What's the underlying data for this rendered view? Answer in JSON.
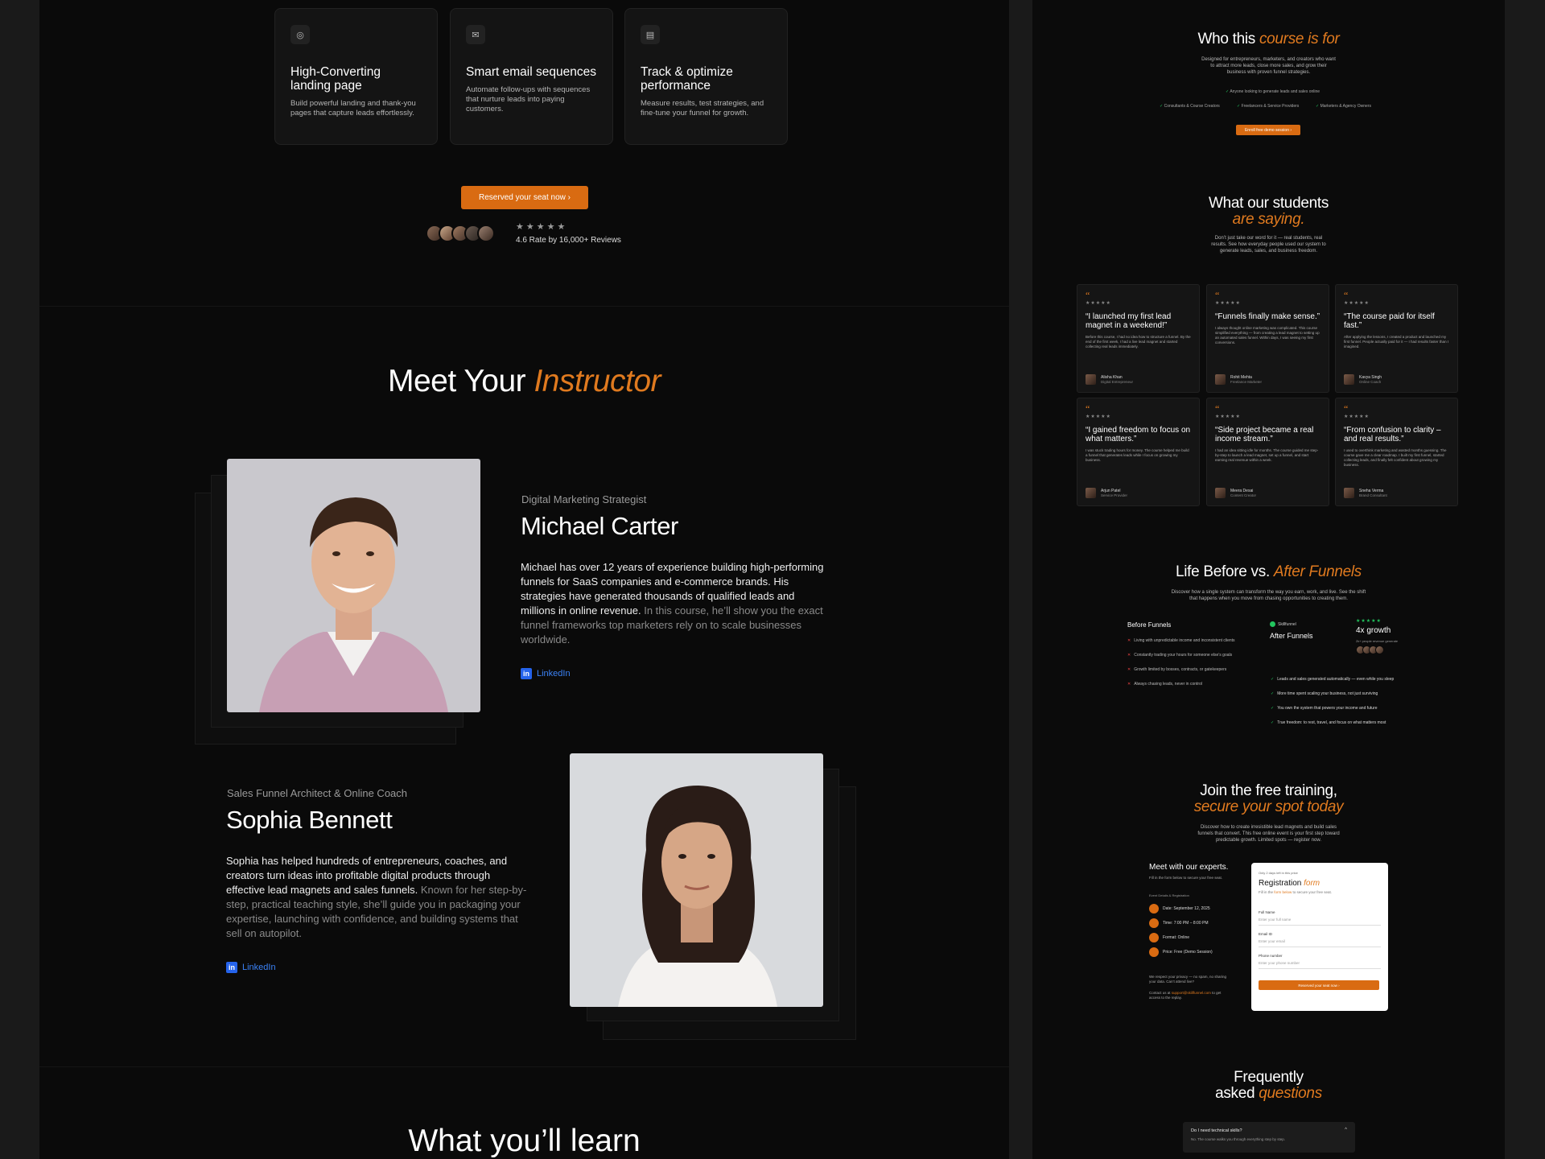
{
  "features": [
    {
      "icon": "globe-icon",
      "title": "High-Converting landing page",
      "desc": "Build powerful landing and thank-you pages that capture leads effortlessly."
    },
    {
      "icon": "mail-icon",
      "title": "Smart email sequences",
      "desc": "Automate follow-ups with sequences that nurture leads into paying customers."
    },
    {
      "icon": "chart-file-icon",
      "title": "Track & optimize performance",
      "desc": "Measure results, test strategies, and fine-tune your funnel for growth."
    }
  ],
  "cta": {
    "reserve_label": "Reserved your seat now  ›"
  },
  "rating": {
    "stars": "★★★★★",
    "text": "4.6 Rate by 16,000+ Reviews"
  },
  "meet": {
    "title_a": "Meet Your ",
    "title_b": "Instructor"
  },
  "instructors": [
    {
      "role": "Digital Marketing Strategist",
      "name": "Michael Carter",
      "bio_main": "Michael has over 12 years of experience building high-performing funnels for SaaS companies and e-commerce brands. His strategies have generated thousands of qualified leads and millions in online revenue.",
      "bio_muted": " In this course, he’ll show you the exact funnel frameworks top marketers rely on to scale businesses worldwide.",
      "link": "LinkedIn"
    },
    {
      "role": "Sales Funnel Architect & Online Coach",
      "name": "Sophia Bennett",
      "bio_main": "Sophia has helped hundreds of entrepreneurs, coaches, and creators turn ideas into profitable digital products through effective lead magnets and sales funnels.",
      "bio_muted": " Known for her step-by-step, practical teaching style, she’ll guide you in packaging your expertise, launching with confidence, and building systems that sell on autopilot.",
      "link": "LinkedIn"
    }
  ],
  "learn": {
    "title": "What you’ll learn"
  },
  "who": {
    "title_a": "Who this ",
    "title_b": "course is for",
    "desc": "Designed for entrepreneurs, marketers, and creators who want to attract more leads, close more sales, and grow their business with proven funnel strategies.",
    "tags": [
      "Anyone looking to generate leads and sales online",
      "Consultants & Course Creators",
      "Freelancers & Service Providers",
      "Marketers & Agency Owners"
    ],
    "btn": "Enroll free demo session  ›"
  },
  "students": {
    "title_a": "What our students",
    "title_b": "are saying.",
    "desc": "Don’t just take our word for it — real students, real results. See how everyday people used our system to generate leads, sales, and business freedom.",
    "cards": [
      {
        "title": "“I launched my first lead magnet in a weekend!”",
        "body": "Before this course, I had no idea how to structure a funnel. By the end of the first week, I had a live lead magnet and started collecting real leads immediately.",
        "name": "Alisha Khan",
        "role": "Digital Entrepreneur"
      },
      {
        "title": "“Funnels finally make sense.”",
        "body": "I always thought online marketing was complicated. This course simplified everything — from creating a lead magnet to setting up an automated sales funnel. Within days, I was seeing my first conversions.",
        "name": "Rohit Mehta",
        "role": "Freelance Marketer"
      },
      {
        "title": "“The course paid for itself fast.”",
        "body": "After applying the lessons, I created a product and launched my first funnel. People actually paid for it — I had results faster than I imagined.",
        "name": "Kavya Singh",
        "role": "Online Coach"
      },
      {
        "title": "“I gained freedom to focus on what matters.”",
        "body": "I was stuck trading hours for money. The course helped me build a funnel that generates leads while I focus on growing my business.",
        "name": "Arjun Patel",
        "role": "Service Provider"
      },
      {
        "title": "“Side project became a real income stream.”",
        "body": "I had an idea sitting idle for months. The course guided me step-by-step to launch a lead magnet, set up a funnel, and start earning real revenue within a week.",
        "name": "Meera Desai",
        "role": "Content Creator"
      },
      {
        "title": "“From confusion to clarity – and real results.”",
        "body": "I used to overthink marketing and wasted months guessing. The course gave me a clear roadmap. I built my first funnel, started collecting leads, and finally felt confident about growing my business.",
        "name": "Sneha Verma",
        "role": "Brand Consultant"
      }
    ],
    "stars": "★★★★★"
  },
  "life": {
    "title_a": "Life Before vs. ",
    "title_b": "After Funnels",
    "desc": "Discover how a single system can transform the way you earn, work, and live. See the shift that happens when you move from chasing opportunities to creating them.",
    "before_title": "Before Funnels",
    "before": [
      "Living with unpredictable income and inconsistent clients",
      "Constantly trading your hours for someone else’s goals",
      "Growth limited by bosses, contracts, or gatekeepers",
      "Always chasing leads, never in control"
    ],
    "brand": "Skillfunnel",
    "after_title": "After Funnels",
    "growth_stars": "★★★★★",
    "growth": "4x growth",
    "growth_sub": "2k+ people revenue generate",
    "after": [
      "Leads and sales generated automatically — even while you sleep",
      "More time spent scaling your business, not just surviving",
      "You own the system that powers your income and future",
      "True freedom: to rest, travel, and focus on what matters most"
    ]
  },
  "join": {
    "title_a": "Join the free training,",
    "title_b": "secure your spot today",
    "desc": "Discover how to create irresistible lead magnets and build sales funnels that convert. This free online event is your first step toward predictable growth. Limited spots — register now.",
    "meet_title": "Meet with our experts.",
    "meet_sub": "Fill in the form below to secure your free seat.",
    "event_label": "Event Details & Registration",
    "details": [
      "Date: September 12, 2025",
      "Time: 7:00 PM – 8:00 PM",
      "Format: Online",
      "Price: Free (Demo Session)"
    ],
    "privacy": "We respect your privacy — no spam, no sharing your data. Can’t attend live?",
    "contact_a": "Contact us at ",
    "contact_email": "support@skillfunnel.com",
    "contact_b": " to get access to the replay."
  },
  "reg": {
    "badge": "Only 2 days left in this price",
    "title_a": "Registration ",
    "title_b": "form",
    "sub_a": "Fill in the ",
    "sub_b": "form below",
    "sub_c": " to secure your free seat.",
    "fields": [
      {
        "label": "Full Name",
        "placeholder": "Enter your full name"
      },
      {
        "label": "Email ID",
        "placeholder": "Enter your email"
      },
      {
        "label": "Phone number",
        "placeholder": "Enter your phone number"
      }
    ],
    "submit": "Reserved your seat now  ›"
  },
  "faq": {
    "title_a": "Frequently",
    "title_b_a": "asked ",
    "title_b_b": "questions",
    "q": "Do I need technical skills?",
    "a": "No. The course walks you through everything step by step.",
    "chevron": "^"
  }
}
